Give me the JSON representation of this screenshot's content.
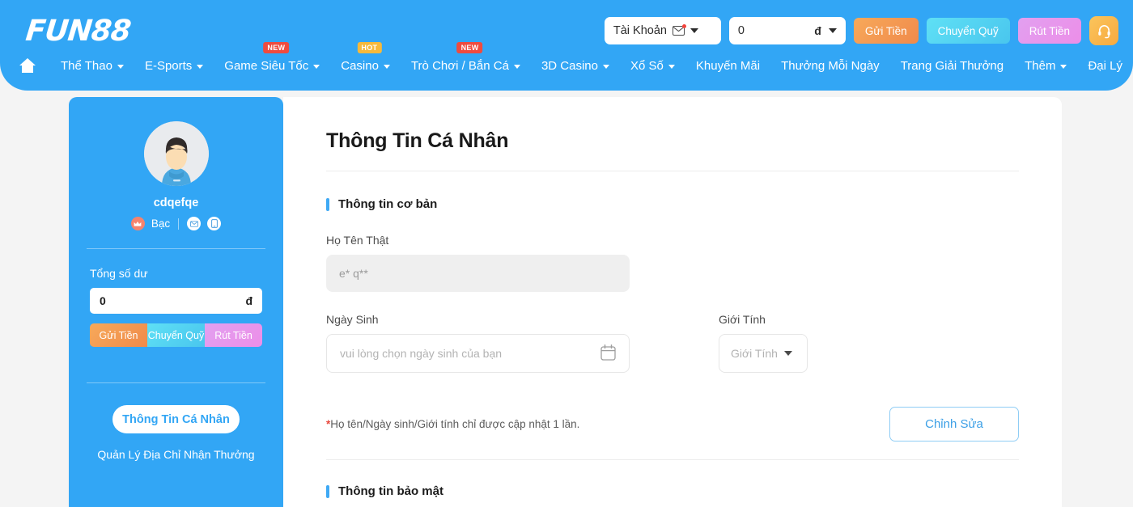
{
  "header": {
    "logo": "FUN88",
    "account_pill": {
      "label": "Tài Khoản",
      "icon": "mail-icon"
    },
    "balance_pill": {
      "value": "0",
      "currency": "đ"
    },
    "buttons": [
      {
        "id": "deposit",
        "label": "Gửi Tiền",
        "color": "#f39a52"
      },
      {
        "id": "transfer",
        "label": "Chuyển Quỹ",
        "color": "#52d3ef"
      },
      {
        "id": "withdraw",
        "label": "Rút Tiền",
        "color": "#e897ec"
      }
    ],
    "support_icon": "headset-icon",
    "nav": [
      {
        "id": "home",
        "label": "",
        "icon": "home-icon",
        "caret": false,
        "badge": null
      },
      {
        "id": "the-thao",
        "label": "Thể Thao",
        "caret": true,
        "badge": null
      },
      {
        "id": "e-sports",
        "label": "E-Sports",
        "caret": true,
        "badge": null
      },
      {
        "id": "sieu-toc",
        "label": "Game Siêu Tốc",
        "caret": true,
        "badge": "NEW",
        "badge_type": "new"
      },
      {
        "id": "casino",
        "label": "Casino",
        "caret": true,
        "badge": "HOT",
        "badge_type": "hot"
      },
      {
        "id": "tro-choi",
        "label": "Trò Chơi / Bắn Cá",
        "caret": true,
        "badge": "NEW",
        "badge_type": "new"
      },
      {
        "id": "3d-casino",
        "label": "3D Casino",
        "caret": true,
        "badge": null
      },
      {
        "id": "xo-so",
        "label": "Xổ Số",
        "caret": true,
        "badge": null
      },
      {
        "id": "khuyen-mai",
        "label": "Khuyến Mãi",
        "caret": false,
        "badge": null
      },
      {
        "id": "thuong",
        "label": "Thưởng Mỗi Ngày",
        "caret": false,
        "badge": null
      },
      {
        "id": "giai-thuong",
        "label": "Trang Giải Thưởng",
        "caret": false,
        "badge": null
      },
      {
        "id": "them",
        "label": "Thêm",
        "caret": true,
        "badge": null
      },
      {
        "id": "dai-ly",
        "label": "Đại Lý",
        "caret": false,
        "badge": null
      }
    ]
  },
  "sidebar": {
    "username": "cdqefqe",
    "rank": "Bạc",
    "rank_icon": "crown-icon",
    "contact_icons": [
      "envelope-icon",
      "phone-icon"
    ],
    "balance_label": "Tổng số dư",
    "balance_value": "0",
    "balance_currency": "đ",
    "actions": [
      {
        "id": "deposit",
        "label": "Gửi Tiền"
      },
      {
        "id": "transfer",
        "label": "Chuyển Quỹ"
      },
      {
        "id": "withdraw",
        "label": "Rút Tiền"
      }
    ],
    "menu": [
      {
        "id": "profile",
        "label": "Thông Tin Cá Nhân",
        "active": true
      },
      {
        "id": "address",
        "label": "Quản Lý Địa Chỉ Nhận Thưởng",
        "active": false
      }
    ]
  },
  "main": {
    "page_title": "Thông Tin Cá Nhân",
    "section_basic": {
      "title": "Thông tin cơ bản",
      "fullname": {
        "label": "Họ Tên Thật",
        "value": "e* q**"
      },
      "birthdate": {
        "label": "Ngày Sinh",
        "placeholder": "vui lòng chọn ngày sinh của bạn",
        "icon": "calendar-icon"
      },
      "gender": {
        "label": "Giới Tính",
        "placeholder": "Giới Tính",
        "icon": "chevron-down-icon"
      }
    },
    "note": {
      "star": "*",
      "text": "Họ tên/Ngày sinh/Giới tính chỉ được cập nhật 1 lần."
    },
    "edit_button": "Chỉnh Sửa",
    "section_security": {
      "title": "Thông tin bảo mật"
    }
  },
  "colors": {
    "brand_blue": "#32a6f5",
    "accent_bar": "#3fa9f5",
    "note_star": "#e8473c",
    "page_bg": "#f4f4f4"
  }
}
